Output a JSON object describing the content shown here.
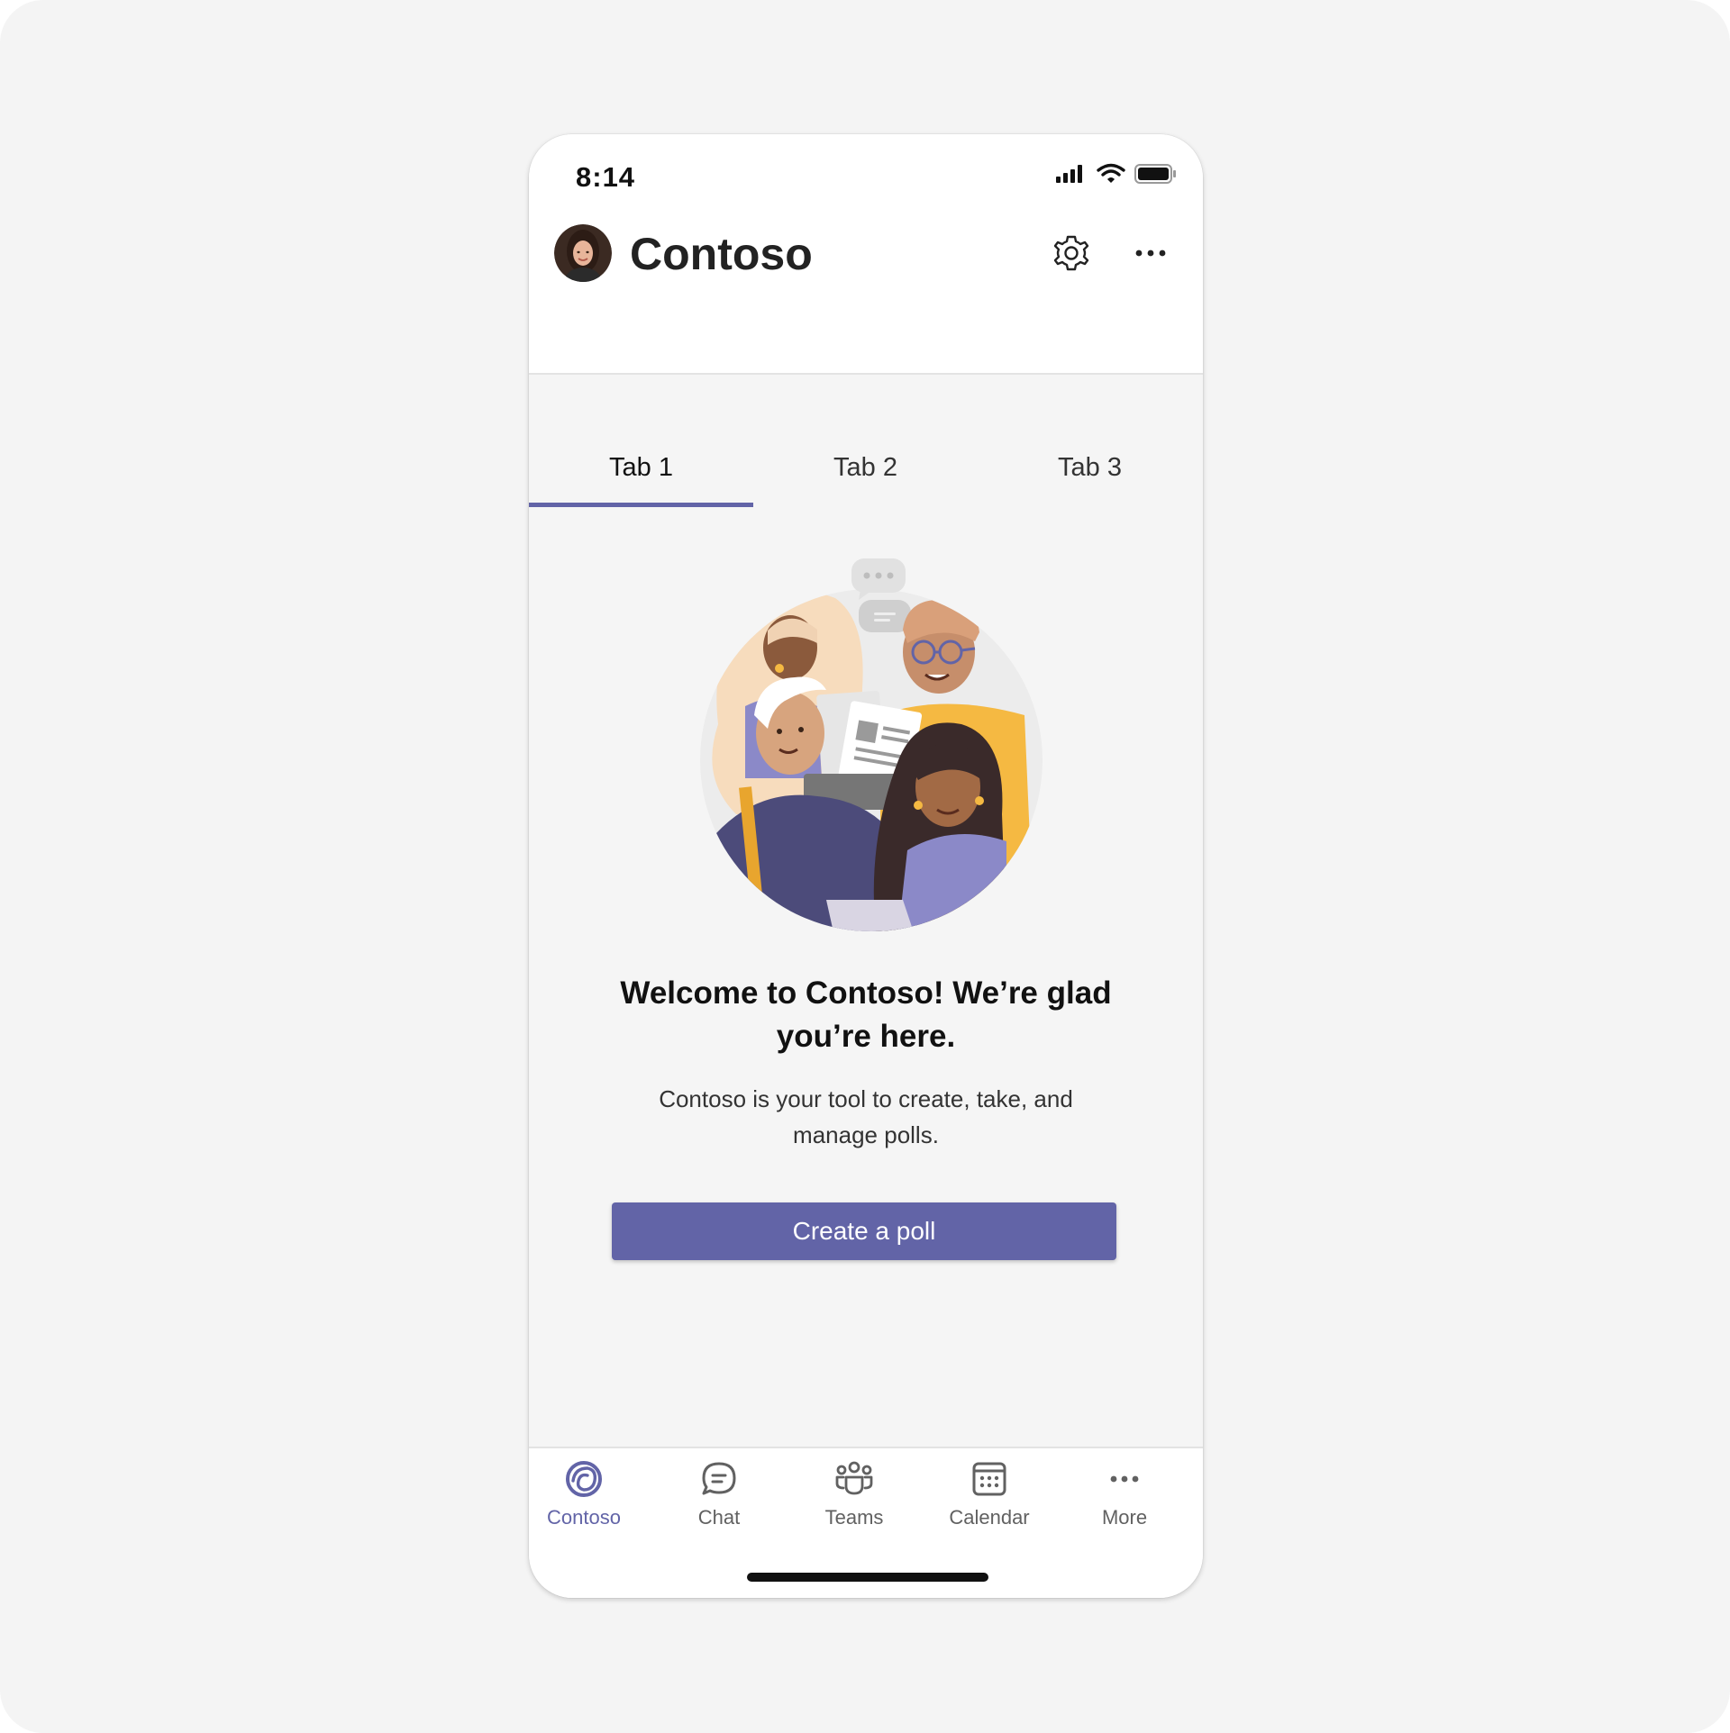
{
  "status": {
    "time": "8:14"
  },
  "header": {
    "title": "Contoso",
    "settings_icon": "gear-icon",
    "more_icon": "more-horizontal-icon"
  },
  "tabs": [
    {
      "label": "Tab 1",
      "active": true
    },
    {
      "label": "Tab 2",
      "active": false
    },
    {
      "label": "Tab 3",
      "active": false
    }
  ],
  "main": {
    "heading": "Welcome to Contoso! We’re glad you’re here.",
    "description": "Contoso is your tool to create, take, and manage polls.",
    "cta_label": "Create a poll"
  },
  "bottom_nav": [
    {
      "label": "Contoso",
      "icon": "contoso-app-icon",
      "active": true
    },
    {
      "label": "Chat",
      "icon": "chat-icon",
      "active": false
    },
    {
      "label": "Teams",
      "icon": "teams-icon",
      "active": false
    },
    {
      "label": "Calendar",
      "icon": "calendar-icon",
      "active": false
    },
    {
      "label": "More",
      "icon": "more-horizontal-icon",
      "active": false
    }
  ],
  "colors": {
    "accent": "#6264a7",
    "background": "#f5f5f5",
    "surface": "#ffffff",
    "text": "#111111"
  }
}
